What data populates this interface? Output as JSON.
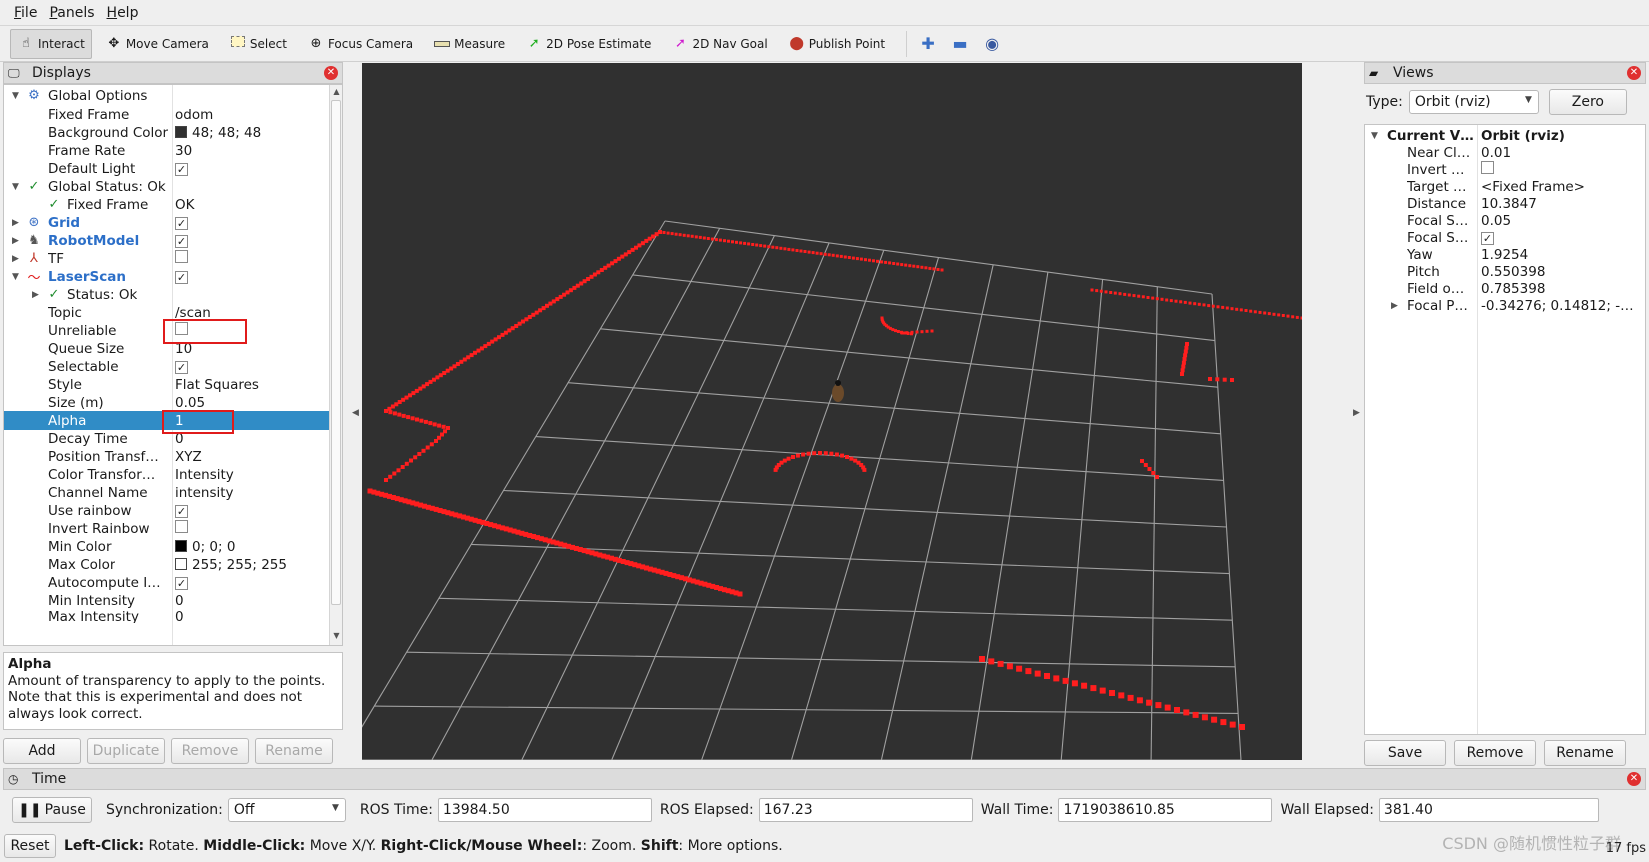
{
  "menu": [
    "File",
    "Panels",
    "Help"
  ],
  "toolbar": {
    "tools": [
      "Interact",
      "Move Camera",
      "Select",
      "Focus Camera",
      "Measure",
      "2D Pose Estimate",
      "2D Nav Goal",
      "Publish Point"
    ]
  },
  "displays": {
    "title": "Displays",
    "rows": {
      "global_options": "Global Options",
      "fixed_frame_label": "Fixed Frame",
      "fixed_frame_value": "odom",
      "bg_color_label": "Background Color",
      "bg_color_value": "48; 48; 48",
      "frame_rate_label": "Frame Rate",
      "frame_rate_value": "30",
      "default_light_label": "Default Light",
      "global_status": "Global Status: Ok",
      "fixed_frame_status_label": "Fixed Frame",
      "fixed_frame_status_value": "OK",
      "grid": "Grid",
      "robot_model": "RobotModel",
      "tf": "TF",
      "laser_scan": "LaserScan",
      "status_ok": "Status: Ok",
      "topic_label": "Topic",
      "topic_value": "/scan",
      "unreliable_label": "Unreliable",
      "queue_size_label": "Queue Size",
      "queue_size_value": "10",
      "selectable_label": "Selectable",
      "style_label": "Style",
      "style_value": "Flat Squares",
      "size_label": "Size (m)",
      "size_value": "0.05",
      "alpha_label": "Alpha",
      "alpha_value": "1",
      "decay_label": "Decay Time",
      "decay_value": "0",
      "pos_transform_label": "Position Transf…",
      "pos_transform_value": "XYZ",
      "color_transform_label": "Color Transfor…",
      "color_transform_value": "Intensity",
      "channel_label": "Channel Name",
      "channel_value": "intensity",
      "use_rainbow_label": "Use rainbow",
      "invert_rainbow_label": "Invert Rainbow",
      "min_color_label": "Min Color",
      "min_color_value": "0; 0; 0",
      "max_color_label": "Max Color",
      "max_color_value": "255; 255; 255",
      "autocompute_label": "Autocompute I…",
      "min_intensity_label": "Min Intensity",
      "min_intensity_value": "0",
      "max_intensity_label": "Max Intensity",
      "max_intensity_value": "0"
    },
    "description_title": "Alpha",
    "description_text": "Amount of transparency to apply to the points. Note that this is experimental and does not always look correct.",
    "buttons": {
      "add": "Add",
      "duplicate": "Duplicate",
      "remove": "Remove",
      "rename": "Rename"
    }
  },
  "views": {
    "title": "Views",
    "type_label": "Type:",
    "type_value": "Orbit (rviz)",
    "zero_button": "Zero",
    "rows": [
      {
        "label": "Current V…",
        "value": "Orbit (rviz)"
      },
      {
        "label": "Near Cl…",
        "value": "0.01"
      },
      {
        "label": "Invert …",
        "value": ""
      },
      {
        "label": "Target …",
        "value": "<Fixed Frame>"
      },
      {
        "label": "Distance",
        "value": "10.3847"
      },
      {
        "label": "Focal S…",
        "value": "0.05"
      },
      {
        "label": "Focal S…",
        "value": ""
      },
      {
        "label": "Yaw",
        "value": "1.9254"
      },
      {
        "label": "Pitch",
        "value": "0.550398"
      },
      {
        "label": "Field o…",
        "value": "0.785398"
      },
      {
        "label": "Focal P…",
        "value": "-0.34276; 0.14812; -…"
      }
    ],
    "buttons": {
      "save": "Save",
      "remove": "Remove",
      "rename": "Rename"
    }
  },
  "time": {
    "title": "Time",
    "pause": "Pause",
    "sync_label": "Synchronization:",
    "sync_value": "Off",
    "ros_time_label": "ROS Time:",
    "ros_time_value": "13984.50",
    "ros_elapsed_label": "ROS Elapsed:",
    "ros_elapsed_value": "167.23",
    "wall_time_label": "Wall Time:",
    "wall_time_value": "1719038610.85",
    "wall_elapsed_label": "Wall Elapsed:",
    "wall_elapsed_value": "381.40"
  },
  "status": {
    "reset": "Reset",
    "left_click_key": "Left-Click:",
    "left_click_text": "Rotate.",
    "middle_click_key": "Middle-Click:",
    "middle_click_text": "Move X/Y.",
    "right_click_key": "Right-Click/Mouse Wheel:",
    "right_click_text": ":  Zoom.",
    "shift_key": "Shift",
    "shift_text": ": More options.",
    "fps": "17 fps",
    "watermark": "CSDN @随机惯性粒子群"
  },
  "colors": {
    "selection": "#308cc6",
    "background_3d": "#303030",
    "laser": "#ff1e1e",
    "grid": "#a0a0a0"
  }
}
